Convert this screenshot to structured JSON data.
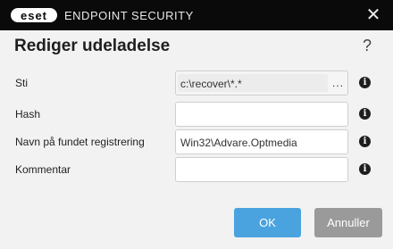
{
  "window": {
    "logo_text": "eset",
    "app_title": "ENDPOINT SECURITY",
    "close_glyph": "✕"
  },
  "dialog": {
    "title": "Rediger udeladelse",
    "help_glyph": "?",
    "fields": {
      "path": {
        "label": "Sti",
        "value": "c:\\recover\\*.*",
        "browse_label": "..."
      },
      "hash": {
        "label": "Hash",
        "value": ""
      },
      "detection": {
        "label": "Navn på fundet registrering",
        "value": "Win32\\Advare.Optmedia"
      },
      "comment": {
        "label": "Kommentar",
        "value": ""
      }
    },
    "info_glyph": "i"
  },
  "buttons": {
    "ok_label": "OK",
    "cancel_label": "Annuller"
  },
  "colors": {
    "titlebar": "#0a0a0a",
    "ok_button": "#4aa3df",
    "cancel_button": "#9a9a9a"
  }
}
